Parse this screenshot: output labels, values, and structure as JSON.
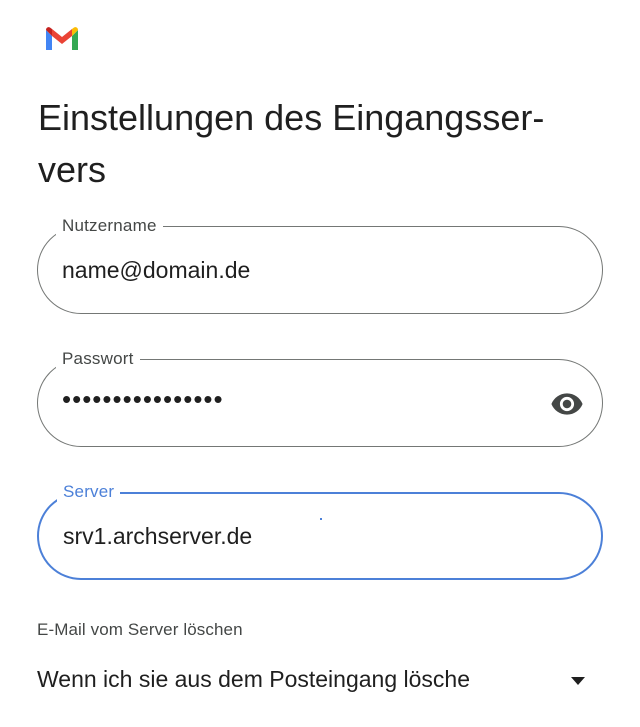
{
  "app": {
    "logo_icon": "gmail-logo-icon"
  },
  "page": {
    "title": "Einstellungen des Eingangsser-vers"
  },
  "form": {
    "username": {
      "label": "Nutzername",
      "value": "name@domain.de"
    },
    "password": {
      "label": "Passwort",
      "value": "••••••••••••••••",
      "toggle_icon": "eye-icon"
    },
    "server": {
      "label": "Server",
      "value": "srv1.archserver.de"
    },
    "delete_from_server": {
      "label": "E-Mail vom Server löschen",
      "selected": "Wenn ich sie aus dem Posteingang lösche",
      "dropdown_icon": "caret-down-icon"
    }
  },
  "colors": {
    "accent": "#4c80d8",
    "border": "#747775",
    "text": "#1f1f1f",
    "label": "#444746"
  }
}
